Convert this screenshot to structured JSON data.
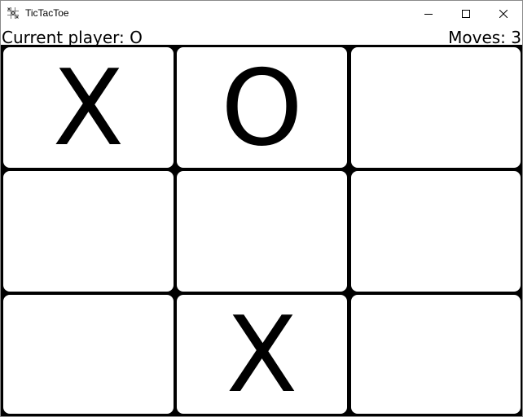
{
  "window": {
    "title": "TicTacToe",
    "icons": {
      "app": "tictactoe-app-icon",
      "minimize": "minimize-icon",
      "maximize": "maximize-icon",
      "close": "close-icon"
    }
  },
  "status": {
    "current_player": "Current player: O",
    "moves": "Moves: 3"
  },
  "board": {
    "cells": [
      [
        "X",
        "O",
        ""
      ],
      [
        "",
        "",
        ""
      ],
      [
        "",
        "X",
        ""
      ]
    ]
  },
  "colors": {
    "background": "#ffffff",
    "grid": "#000000",
    "mark": "#000000"
  }
}
